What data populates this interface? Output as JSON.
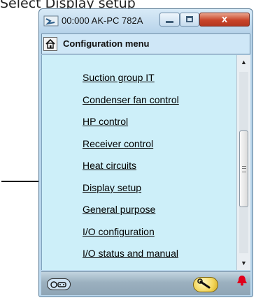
{
  "caption": "Select Display setup",
  "window": {
    "title": "00:000 AK-PC 782A",
    "buttons": {
      "minimize": "minimize",
      "maximize": "maximize",
      "close": "x"
    }
  },
  "header": {
    "title": "Configuration menu"
  },
  "menu": {
    "items": [
      {
        "label": "Suction group IT"
      },
      {
        "label": "Condenser fan control"
      },
      {
        "label": "HP control"
      },
      {
        "label": "Receiver control"
      },
      {
        "label": "Heat circuits"
      },
      {
        "label": "Display setup"
      },
      {
        "label": "General purpose"
      },
      {
        "label": "I/O configuration"
      },
      {
        "label": "I/O status and manual"
      }
    ],
    "highlighted_item": "Display setup"
  },
  "scrollbar": {
    "up_glyph": "▲",
    "down_glyph": "▼"
  },
  "colors": {
    "window_bg": "#b9d6ec",
    "list_bg": "#cdeff9",
    "close_button": "#c9452a",
    "alarm": "#e0001b"
  },
  "icons": [
    "connection-icon",
    "home-icon",
    "tools-icon",
    "service-wrench-icon",
    "alarm-bell-icon",
    "pointer-arrow"
  ]
}
